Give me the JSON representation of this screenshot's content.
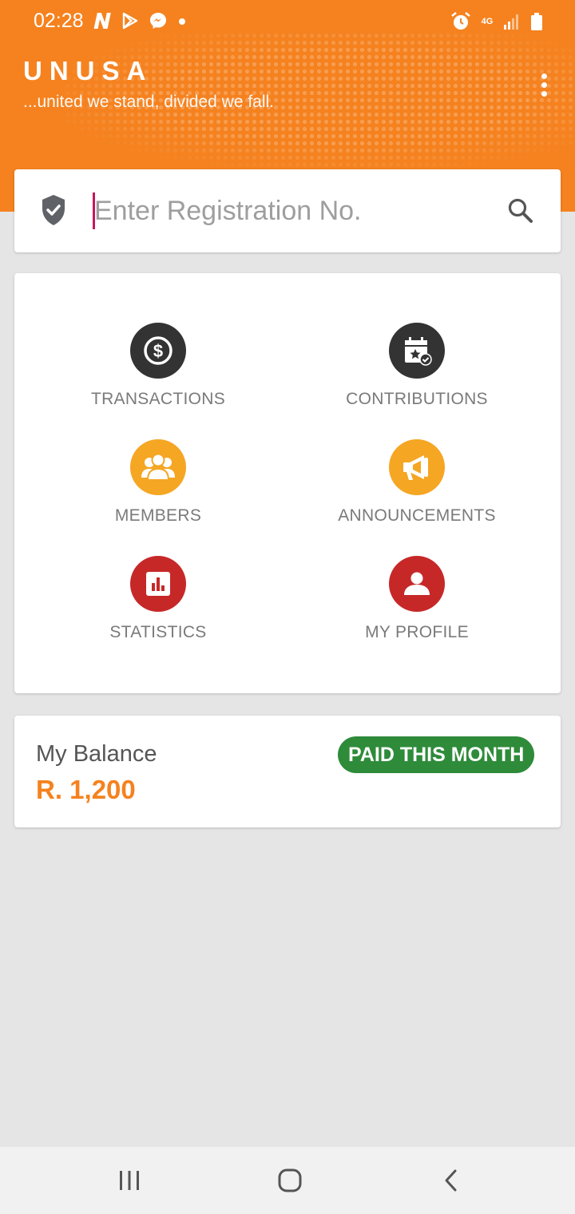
{
  "status_bar": {
    "time": "02:28",
    "network": "4G",
    "icons": [
      "netflix-n-icon",
      "play-store-icon",
      "messenger-icon",
      "notification-dot-icon",
      "alarm-icon",
      "signal-icon",
      "battery-icon"
    ]
  },
  "header": {
    "title": "UNUSA",
    "tagline": "...united we stand, divided we fall.",
    "menu_icon": "more-vert-icon"
  },
  "search": {
    "placeholder": "Enter Registration No.",
    "value": "",
    "shield_icon": "verified-shield-icon",
    "search_icon": "search-icon"
  },
  "menu": {
    "items": [
      {
        "label": "TRANSACTIONS",
        "icon": "dollar-icon",
        "color": "#333333"
      },
      {
        "label": "CONTRIBUTIONS",
        "icon": "calendar-star-icon",
        "color": "#333333"
      },
      {
        "label": "MEMBERS",
        "icon": "group-icon",
        "color": "#f5a623"
      },
      {
        "label": "ANNOUNCEMENTS",
        "icon": "megaphone-icon",
        "color": "#f5a623"
      },
      {
        "label": "STATISTICS",
        "icon": "bar-chart-icon",
        "color": "#c62828"
      },
      {
        "label": "MY PROFILE",
        "icon": "person-icon",
        "color": "#c62828"
      }
    ]
  },
  "balance": {
    "title": "My Balance",
    "value": "R. 1,200",
    "badge": "PAID THIS MONTH",
    "badge_color": "#2e8b3a"
  },
  "colors": {
    "primary": "#f5821f",
    "background": "#e5e5e5",
    "caret": "#c2185b"
  },
  "nav_bar": {
    "icons": [
      "recent-apps-icon",
      "home-icon",
      "back-icon"
    ]
  }
}
